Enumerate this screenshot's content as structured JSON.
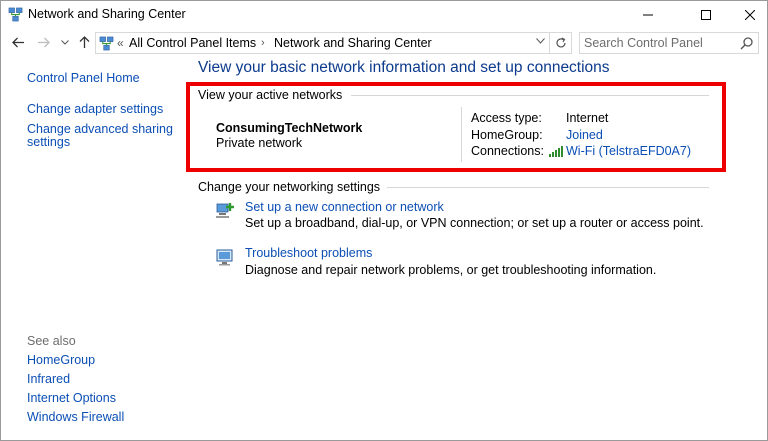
{
  "window": {
    "title": "Network and Sharing Center",
    "icon": "network-center-icon"
  },
  "address_bar": {
    "prefix": "«",
    "crumbs": [
      "All Control Panel Items",
      "Network and Sharing Center"
    ],
    "search_placeholder": "Search Control Panel"
  },
  "left_pane": {
    "links": [
      "Control Panel Home",
      "Change adapter settings",
      "Change advanced sharing settings"
    ],
    "see_also_label": "See also",
    "see_also_links": [
      "HomeGroup",
      "Infrared",
      "Internet Options",
      "Windows Firewall"
    ]
  },
  "main": {
    "title": "View your basic network information and set up connections",
    "active_networks_heading": "View your active networks",
    "network": {
      "name": "ConsumingTechNetwork",
      "type": "Private network",
      "access_type_label": "Access type:",
      "access_type_value": "Internet",
      "homegroup_label": "HomeGroup:",
      "homegroup_value": "Joined",
      "connections_label": "Connections:",
      "connections_value": "Wi-Fi (TelstraEFD0A7)"
    },
    "change_settings_heading": "Change your networking settings",
    "tasks": [
      {
        "link": "Set up a new connection or network",
        "description": "Set up a broadband, dial-up, or VPN connection; or set up a router or access point.",
        "icon": "new-connection-icon"
      },
      {
        "link": "Troubleshoot problems",
        "description": "Diagnose and repair network problems, or get troubleshooting information.",
        "icon": "troubleshoot-icon"
      }
    ]
  },
  "colors": {
    "link": "#0b4fb5",
    "title": "#0c3a8c",
    "highlight": "#ee0000"
  }
}
